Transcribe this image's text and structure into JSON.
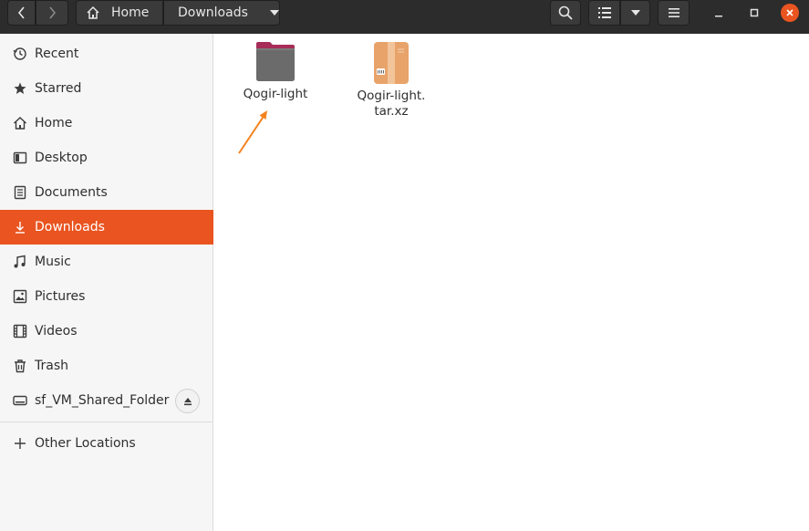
{
  "header": {
    "path": {
      "home_label": "Home",
      "current_label": "Downloads"
    },
    "icons": [
      "back-arrow-icon",
      "forward-arrow-icon",
      "home-icon",
      "dropdown-icon",
      "search-icon",
      "list-view-icon",
      "chevron-down-icon",
      "hamburger-menu-icon",
      "minimize-icon",
      "maximize-icon",
      "close-icon"
    ]
  },
  "sidebar": {
    "items": [
      {
        "label": "Recent",
        "icon": "clock-icon"
      },
      {
        "label": "Starred",
        "icon": "star-icon"
      },
      {
        "label": "Home",
        "icon": "home-icon"
      },
      {
        "label": "Desktop",
        "icon": "desktop-icon"
      },
      {
        "label": "Documents",
        "icon": "document-icon"
      },
      {
        "label": "Downloads",
        "icon": "download-icon",
        "active": true
      },
      {
        "label": "Music",
        "icon": "music-icon"
      },
      {
        "label": "Pictures",
        "icon": "picture-icon"
      },
      {
        "label": "Videos",
        "icon": "video-icon"
      },
      {
        "label": "Trash",
        "icon": "trash-icon"
      },
      {
        "label": "sf_VM_Shared_Folder",
        "icon": "drive-icon"
      }
    ],
    "other_locations": {
      "label": "Other Locations",
      "icon": "plus-icon"
    }
  },
  "files": [
    {
      "name_line1": "Qogir-light",
      "name_line2": "",
      "type": "folder"
    },
    {
      "name_line1": "Qogir-light.",
      "name_line2": "tar.xz",
      "type": "archive"
    }
  ],
  "colors": {
    "accent": "#e95420",
    "header_bg": "#2c2c2c",
    "sidebar_bg": "#f6f6f6",
    "arrow": "#f5821f"
  }
}
